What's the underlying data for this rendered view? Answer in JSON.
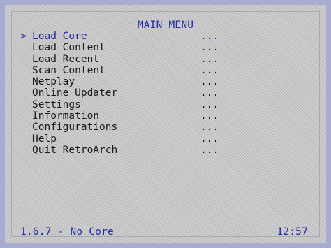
{
  "header": {
    "title": "MAIN MENU"
  },
  "menu": {
    "cursor_glyph": ">",
    "items": [
      {
        "label": "Load Core",
        "value": "...",
        "selected": true
      },
      {
        "label": "Load Content",
        "value": "..."
      },
      {
        "label": "Load Recent",
        "value": "..."
      },
      {
        "label": "Scan Content",
        "value": "..."
      },
      {
        "label": "Netplay",
        "value": "..."
      },
      {
        "label": "Online Updater",
        "value": "..."
      },
      {
        "label": "Settings",
        "value": "..."
      },
      {
        "label": "Information",
        "value": "..."
      },
      {
        "label": "Configurations",
        "value": "..."
      },
      {
        "label": "Help",
        "value": "..."
      },
      {
        "label": "Quit RetroArch",
        "value": "..."
      }
    ]
  },
  "footer": {
    "version": "1.6.7 - No Core",
    "clock": "12:57"
  },
  "colors": {
    "accent": "#1e2aa8",
    "text": "#1a1a1a",
    "border": "#a8acd0",
    "background": "#cbcbcb"
  }
}
